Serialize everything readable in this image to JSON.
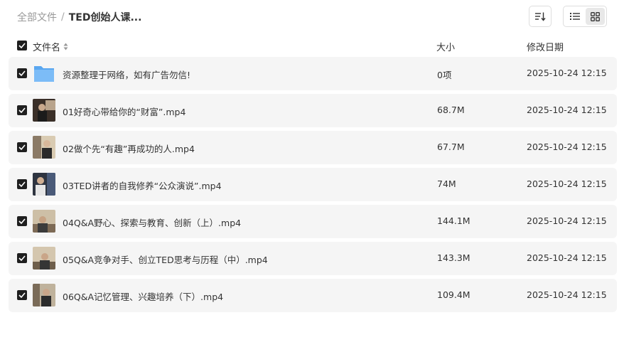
{
  "breadcrumb": {
    "root": "全部文件",
    "separator": "/",
    "current": "TED创始人课..."
  },
  "toolbar": {
    "sort_icon": "sort-icon",
    "list_view_icon": "list-view-icon",
    "grid_view_icon": "grid-view-icon",
    "active_view": "list"
  },
  "header": {
    "name": "文件名",
    "size": "大小",
    "date": "修改日期",
    "sort_icon": "sort-arrows-icon"
  },
  "files": [
    {
      "name": "资源整理于网络，如有广告勿信!",
      "size": "0项",
      "date": "2025-10-24 12:15",
      "type": "folder",
      "checked": true
    },
    {
      "name": "01好奇心带给你的“财富”.mp4",
      "size": "68.7M",
      "date": "2025-10-24 12:15",
      "type": "video",
      "checked": true
    },
    {
      "name": "02做个先“有趣”再成功的人.mp4",
      "size": "67.7M",
      "date": "2025-10-24 12:15",
      "type": "video",
      "checked": true
    },
    {
      "name": "03TED讲者的自我修养“公众演说”.mp4",
      "size": "74M",
      "date": "2025-10-24 12:15",
      "type": "video",
      "checked": true
    },
    {
      "name": "04Q&A野心、探索与教育、创新（上）.mp4",
      "size": "144.1M",
      "date": "2025-10-24 12:15",
      "type": "video",
      "checked": true
    },
    {
      "name": "05Q&A竞争对手、创立TED思考与历程（中）.mp4",
      "size": "143.3M",
      "date": "2025-10-24 12:15",
      "type": "video",
      "checked": true
    },
    {
      "name": "06Q&A记忆管理、兴趣培养（下）.mp4",
      "size": "109.4M",
      "date": "2025-10-24 12:15",
      "type": "video",
      "checked": true
    }
  ],
  "colors": {
    "row_bg": "#f5f5f5",
    "checkbox": "#1f1f1f",
    "folder": "#6fb3f5",
    "muted_text": "#999999"
  }
}
